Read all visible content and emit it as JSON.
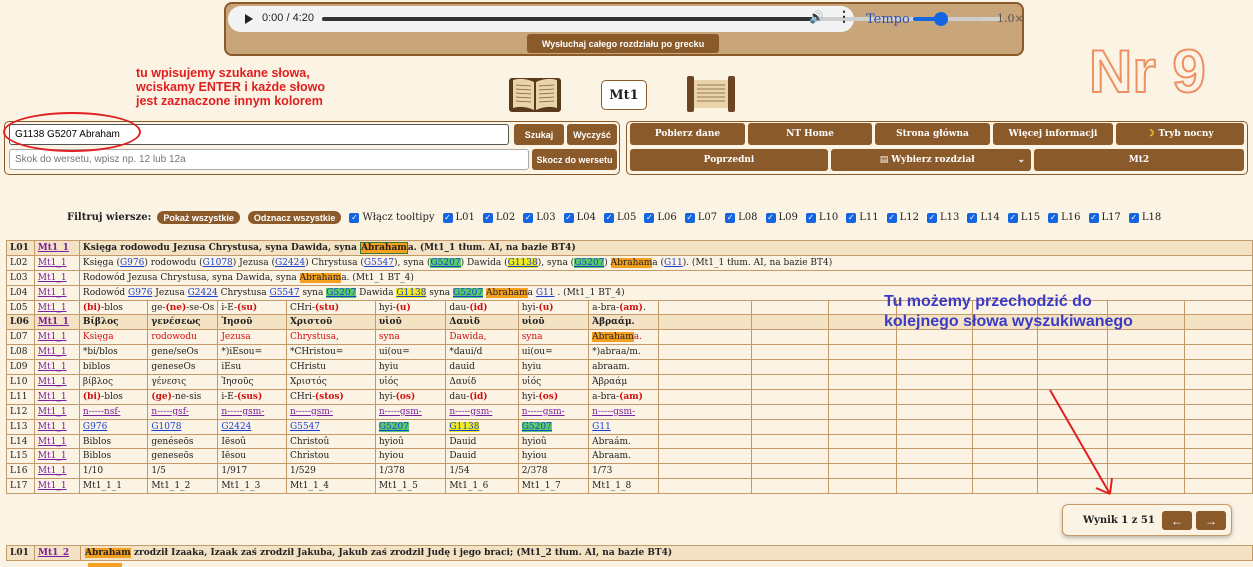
{
  "audio": {
    "time": "0:00 / 4:20",
    "progress": 0.73,
    "tempo_label": "Tempo",
    "tempo_value": "1.0×",
    "tempo_fraction": 0.45,
    "listen_button": "Wysłuchaj całego rozdziału po grecku"
  },
  "annotations": {
    "search_line1": "tu wpisujemy szukane słowa,",
    "search_line2": "wciskamy ENTER i każde słowo",
    "search_line3": "jest zaznaczone innym kolorem",
    "nav_line1": "Tu możemy przechodzić do",
    "nav_line2": "kolejnego słowa wyszukiwanego",
    "big_number": "Nr 9"
  },
  "chapter_badge": "Mt1",
  "search": {
    "value": "G1138 G5207 Abraham",
    "verse_placeholder": "Skok do wersetu, wpisz np. 12 lub 12a",
    "search_button": "Szukaj",
    "clear_button": "Wyczyść",
    "goto_button": "Skocz do wersetu"
  },
  "nav": {
    "download": "Pobierz dane",
    "nt_home": "NT Home",
    "main_page": "Strona główna",
    "more_info": "Więcej informacji",
    "night_mode": "Tryb nocny",
    "previous": "Poprzedni",
    "choose_chapter": "Wybierz rozdział",
    "next": "Mt2"
  },
  "filter": {
    "label": "Filtruj wiersze:",
    "show_all": "Pokaż wszystkie",
    "uncheck_all": "Odznacz wszystkie",
    "tooltips": "Włącz tooltipy",
    "lines": [
      "L01",
      "L02",
      "L03",
      "L04",
      "L05",
      "L06",
      "L07",
      "L08",
      "L09",
      "L10",
      "L11",
      "L12",
      "L13",
      "L14",
      "L15",
      "L16",
      "L17",
      "L18"
    ]
  },
  "verse1": {
    "mark": "Mt1_1",
    "l01_text": "Księga rodowodu Jezusa Chrystusa, syna Dawida, syna ",
    "l01_hl": "Abraham",
    "l01_tail": "a. (Mt1_1 tłum. AI, na bazie BT4)",
    "l02": {
      "p1": "Księga (",
      "g1": "G976",
      "p2": ") rodowodu (",
      "g2": "G1078",
      "p3": ") Jezusa (",
      "g3": "G2424",
      "p4": ") Chrystusa (",
      "g4": "G5547",
      "p5": "), syna (",
      "g5": "G5207",
      "p6": ") Dawida (",
      "g6": "G1138",
      "p7": "), syna (",
      "g7": "G5207",
      "p8": ") ",
      "hl": "Abraham",
      "p9": "a (",
      "g8": "G11",
      "p10": "). (Mt1_1 tłum. AI, na bazie BT4)"
    },
    "l03": {
      "p1": "Rodowód Jezusa Chrystusa, syna Dawida, syna ",
      "hl": "Abraham",
      "p2": "a. (Mt1_1 BT_4)"
    },
    "l04": {
      "p1": "Rodowód ",
      "g1": "G976",
      "p2": " Jezusa ",
      "g2": "G2424",
      "p3": " Chrystusa ",
      "g3": "G5547",
      "p4": " syna ",
      "g4": "G5207",
      "p5": " Dawida ",
      "g5": "G1138",
      "p6": " syna ",
      "g6": "G5207",
      "p7": " ",
      "hl": "Abraham",
      "p8": "a ",
      "g7": "G11",
      "p9": " . (Mt1_1 BT_4)"
    },
    "l05": [
      {
        "a": "(bi)",
        "b": "-blos"
      },
      {
        "a": "ge-",
        "b": "(ne)",
        "c": "-se-Os"
      },
      {
        "a": "i-E-",
        "b": "(su)"
      },
      {
        "a": "CHri-",
        "b": "(stu)"
      },
      {
        "a": "hyi-",
        "b": "(u)"
      },
      {
        "a": "dau-",
        "b": "(id)"
      },
      {
        "a": "hyi-",
        "b": "(u)"
      },
      {
        "a": "a-bra-",
        "b": "(am)",
        "c": "."
      }
    ],
    "l06": [
      "Βίβλος",
      "γενέσεως",
      "Ἰησοῦ",
      "Χριστοῦ",
      "υἱοῦ",
      "Δαυὶδ",
      "υἱοῦ",
      "Ἀβραάμ."
    ],
    "l07": [
      "Księga",
      "rodowodu",
      "Jezusa",
      "Chrystusa,",
      "syna",
      "Dawida,",
      "syna",
      "Abraham"
    ],
    "l07_tail": "a.",
    "l08": [
      "*bi/blos",
      "gene/seOs",
      "*)iEsou=",
      "*CHristou=",
      "ui(ou=",
      "*daui/d",
      "ui(ou=",
      "*)abraa/m."
    ],
    "l09": [
      "biblos",
      "geneseOs",
      "iEsu",
      "CHristu",
      "hyiu",
      "dauid",
      "hyiu",
      "abraam."
    ],
    "l10": [
      "βίβλος",
      "γένεσις",
      "Ἰησοῦς",
      "Χριστός",
      "υἱός",
      "Δαυίδ",
      "υἱός",
      "Ἀβραάμ"
    ],
    "l11": [
      {
        "a": "(bi)",
        "b": "-blos"
      },
      {
        "a": "(ge)",
        "b": "-ne-sis"
      },
      {
        "a": "i-E-",
        "b": "(sus)"
      },
      {
        "a": "CHri-",
        "b": "(stos)"
      },
      {
        "a": "hyi-",
        "b": "(os)"
      },
      {
        "a": "dau-",
        "b": "(id)"
      },
      {
        "a": "hyi-",
        "b": "(os)"
      },
      {
        "a": "a-bra-",
        "b": "(am)"
      }
    ],
    "l12": [
      "n-----nsf-",
      "n-----gsf-",
      "n-----gsm-",
      "n-----gsm-",
      "n-----gsm-",
      "n-----gsm-",
      "n-----gsm-",
      "n-----gsm-"
    ],
    "l13": [
      "G976",
      "G1078",
      "G2424",
      "G5547",
      "G5207",
      "G1138",
      "G5207",
      "G11"
    ],
    "l14": [
      "Biblos",
      "genéseōs",
      "Iēsoû",
      "Christoû",
      "hyioû",
      "Dauid",
      "hyioû",
      "Abraám."
    ],
    "l15": [
      "Biblos",
      "geneseōs",
      "Iēsou",
      "Christou",
      "hyiou",
      "Dauid",
      "hyiou",
      "Abraam."
    ],
    "l16": [
      "1/10",
      "1/5",
      "1/917",
      "1/529",
      "1/378",
      "1/54",
      "2/378",
      "1/73"
    ],
    "l17": [
      "Mt1_1_1",
      "Mt1_1_2",
      "Mt1_1_3",
      "Mt1_1_4",
      "Mt1_1_5",
      "Mt1_1_6",
      "Mt1_1_7",
      "Mt1_1_8"
    ]
  },
  "verse2": {
    "mark": "Mt1_2",
    "l01_hl": "Abraham",
    "l01_tail": " zrodził Izaaka, Izaak zaś zrodził Jakuba, Jakub zaś zrodził Judę i jego braci; (Mt1_2 tłum. AI, na bazie BT4)"
  },
  "result": {
    "text": "Wynik 1 z 51",
    "prev": "←",
    "next": "→"
  }
}
